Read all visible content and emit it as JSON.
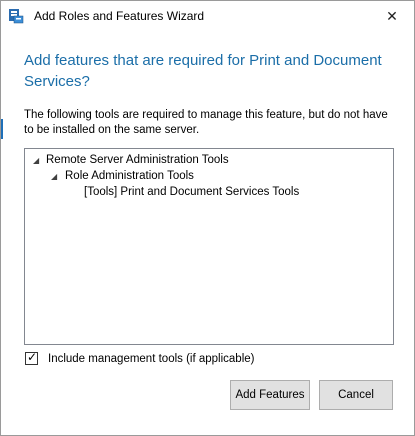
{
  "window": {
    "title": "Add Roles and Features Wizard",
    "close_symbol": "✕"
  },
  "content": {
    "heading": "Add features that are required for Print and Document Services?",
    "description": "The following tools are required to manage this feature, but do not have to be installed on the same server."
  },
  "tree": {
    "items": [
      {
        "label": "Remote Server Administration Tools",
        "toggle": "◢",
        "level": 0
      },
      {
        "label": "Role Administration Tools",
        "toggle": "◢",
        "level": 1
      },
      {
        "label": "[Tools] Print and Document Services Tools",
        "toggle": "",
        "level": 2
      }
    ]
  },
  "options": {
    "include_tools_label": "Include management tools (if applicable)",
    "include_tools_checked": true,
    "check_symbol": "✓"
  },
  "buttons": {
    "add_features": "Add Features",
    "cancel": "Cancel"
  }
}
